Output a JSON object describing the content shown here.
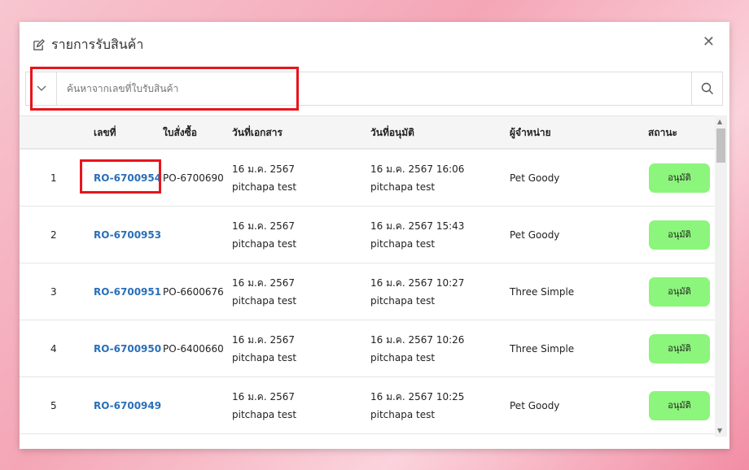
{
  "dialog": {
    "title": "รายการรับสินค้า"
  },
  "search": {
    "placeholder": "ค้นหาจากเลขที่ใบรับสินค้า"
  },
  "columns": [
    "",
    "เลขที่",
    "ใบสั่งซื้อ",
    "วันที่เอกสาร",
    "วันที่อนุมัติ",
    "ผู้จำหน่าย",
    "สถานะ"
  ],
  "rows": [
    {
      "num": "1",
      "ro": "RO-6700954",
      "po": "PO-6700690",
      "doc_date": "16 ม.ค. 2567",
      "doc_user": "pitchapa test",
      "app_date": "16 ม.ค. 2567 16:06",
      "app_user": "pitchapa test",
      "vendor": "Pet Goody",
      "status": "อนุมัติ"
    },
    {
      "num": "2",
      "ro": "RO-6700953",
      "po": "",
      "doc_date": "16 ม.ค. 2567",
      "doc_user": "pitchapa test",
      "app_date": "16 ม.ค. 2567 15:43",
      "app_user": "pitchapa test",
      "vendor": "Pet Goody",
      "status": "อนุมัติ"
    },
    {
      "num": "3",
      "ro": "RO-6700951",
      "po": "PO-6600676",
      "doc_date": "16 ม.ค. 2567",
      "doc_user": "pitchapa test",
      "app_date": "16 ม.ค. 2567 10:27",
      "app_user": "pitchapa test",
      "vendor": "Three Simple",
      "status": "อนุมัติ"
    },
    {
      "num": "4",
      "ro": "RO-6700950",
      "po": "PO-6400660",
      "doc_date": "16 ม.ค. 2567",
      "doc_user": "pitchapa test",
      "app_date": "16 ม.ค. 2567 10:26",
      "app_user": "pitchapa test",
      "vendor": "Three Simple",
      "status": "อนุมัติ"
    },
    {
      "num": "5",
      "ro": "RO-6700949",
      "po": "",
      "doc_date": "16 ม.ค. 2567",
      "doc_user": "pitchapa test",
      "app_date": "16 ม.ค. 2567 10:25",
      "app_user": "pitchapa test",
      "vendor": "Pet Goody",
      "status": "อนุมัติ"
    }
  ],
  "colors": {
    "link": "#2a6fb8",
    "badge": "#8cf57b",
    "highlight": "#e8141c"
  }
}
